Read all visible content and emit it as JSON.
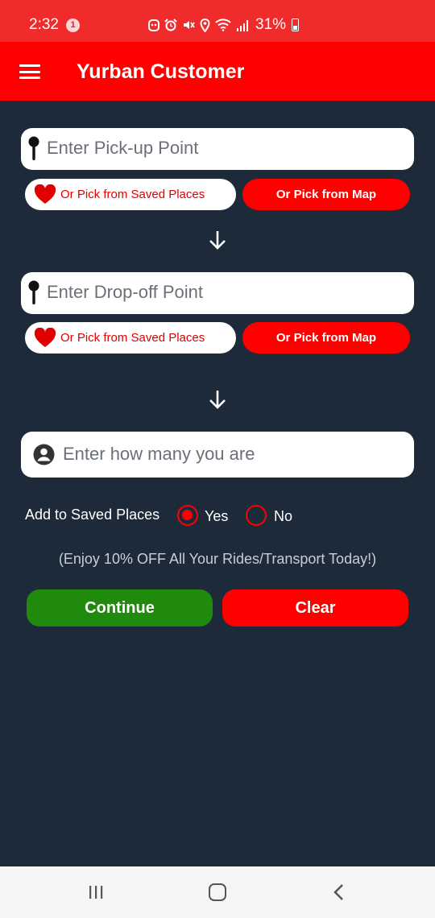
{
  "status_bar": {
    "time": "2:32",
    "notification_count": "1",
    "battery": "31%"
  },
  "app_bar": {
    "title": "Yurban Customer"
  },
  "pickup": {
    "placeholder": "Enter Pick-up Point",
    "saved_label": "Or Pick from Saved Places",
    "map_label": "Or Pick from Map"
  },
  "dropoff": {
    "placeholder": "Enter Drop-off Point",
    "saved_label": "Or Pick from Saved Places",
    "map_label": "Or Pick from Map"
  },
  "passengers": {
    "placeholder": "Enter how many you are"
  },
  "saved_places": {
    "question": "Add to Saved Places",
    "options": [
      "Yes",
      "No"
    ],
    "selected": "Yes"
  },
  "promo": "(Enjoy 10% OFF All Your Rides/Transport Today!)",
  "actions": {
    "continue_label": "Continue",
    "clear_label": "Clear"
  },
  "colors": {
    "accent": "#ff0000",
    "status_bar": "#ef2b2b",
    "background": "#1d2a3a",
    "continue": "#1f8a0c"
  },
  "icons": [
    "menu-icon",
    "pin-icon",
    "heart-icon",
    "arrow-down-icon",
    "person-icon"
  ]
}
